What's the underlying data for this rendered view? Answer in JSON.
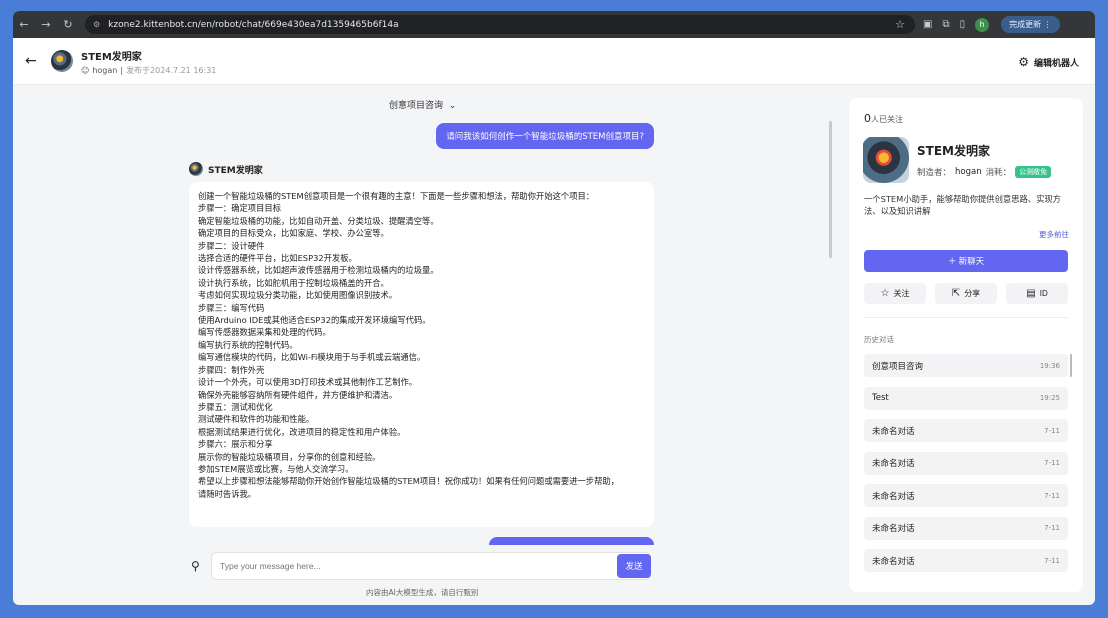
{
  "browser": {
    "url": "kzone2.kittenbot.cn/en/robot/chat/669e430ea7d1359465b6f14a",
    "profile_initial": "h",
    "update_label": "完成更新"
  },
  "header": {
    "title": "STEM发明家",
    "author": "hogan",
    "published": "发布于2024.7.21 16:31",
    "edit_label": "编辑机器人"
  },
  "chat": {
    "topic": "创意项目咨询",
    "user_message": "请问我该如何创作一个智能垃圾桶的STEM创意项目?",
    "bot_name": "STEM发明家",
    "answer_lines": [
      "创建一个智能垃圾桶的STEM创意项目是一个很有趣的主意！下面是一些步骤和想法，帮助你开始这个项目：",
      "步骤一：确定项目目标",
      "确定智能垃圾桶的功能，比如自动开盖、分类垃圾、提醒清空等。",
      "确定项目的目标受众，比如家庭、学校、办公室等。",
      "步骤二：设计硬件",
      "选择合适的硬件平台，比如ESP32开发板。",
      "设计传感器系统，比如超声波传感器用于检测垃圾桶内的垃圾量。",
      "设计执行系统，比如舵机用于控制垃圾桶盖的开合。",
      "考虑如何实现垃圾分类功能，比如使用图像识别技术。",
      "步骤三：编写代码",
      "使用Arduino IDE或其他适合ESP32的集成开发环境编写代码。",
      "编写传感器数据采集和处理的代码。",
      "编写执行系统的控制代码。",
      "编写通信模块的代码，比如Wi-Fi模块用于与手机或云端通信。",
      "步骤四：制作外壳",
      "设计一个外壳，可以使用3D打印技术或其他制作工艺制作。",
      "确保外壳能够容纳所有硬件组件，并方便维护和清洁。",
      "步骤五：测试和优化",
      "测试硬件和软件的功能和性能。",
      "根据测试结果进行优化，改进项目的稳定性和用户体验。",
      "步骤六：展示和分享",
      "展示你的智能垃圾桶项目，分享你的创意和经验。",
      "参加STEM展览或比赛，与他人交流学习。",
      "希望以上步骤和想法能够帮助你开始创作智能垃圾桶的STEM项目！祝你成功！如果有任何问题或需要进一步帮助，",
      "请随时告诉我。"
    ],
    "input_placeholder": "Type your message here...",
    "send_label": "发送",
    "disclaimer": "内容由AI大模型生成，请自行甄别"
  },
  "panel": {
    "followers_count": "0",
    "followers_label": "人已关注",
    "title": "STEM发明家",
    "creator_label": "制造者：",
    "creator": "hogan",
    "cost_label": "消耗：",
    "cost_badge": "公测敞免",
    "description": "一个STEM小助手，能够帮助你提供创意思路、实现方法、以及知识讲解",
    "more_label": "更多前往",
    "new_chat_label": "＋ 新聊天",
    "follow_label": "关注",
    "share_label": "分享",
    "id_label": "ID",
    "history_label": "历史对话",
    "history": [
      {
        "title": "创意项目咨询",
        "time": "19:36"
      },
      {
        "title": "Test",
        "time": "19:25"
      },
      {
        "title": "未命名对话",
        "time": "7-11"
      },
      {
        "title": "未命名对话",
        "time": "7-11"
      },
      {
        "title": "未命名对话",
        "time": "7-11"
      },
      {
        "title": "未命名对话",
        "time": "7-11"
      },
      {
        "title": "未命名对话",
        "time": "7-11"
      }
    ]
  }
}
